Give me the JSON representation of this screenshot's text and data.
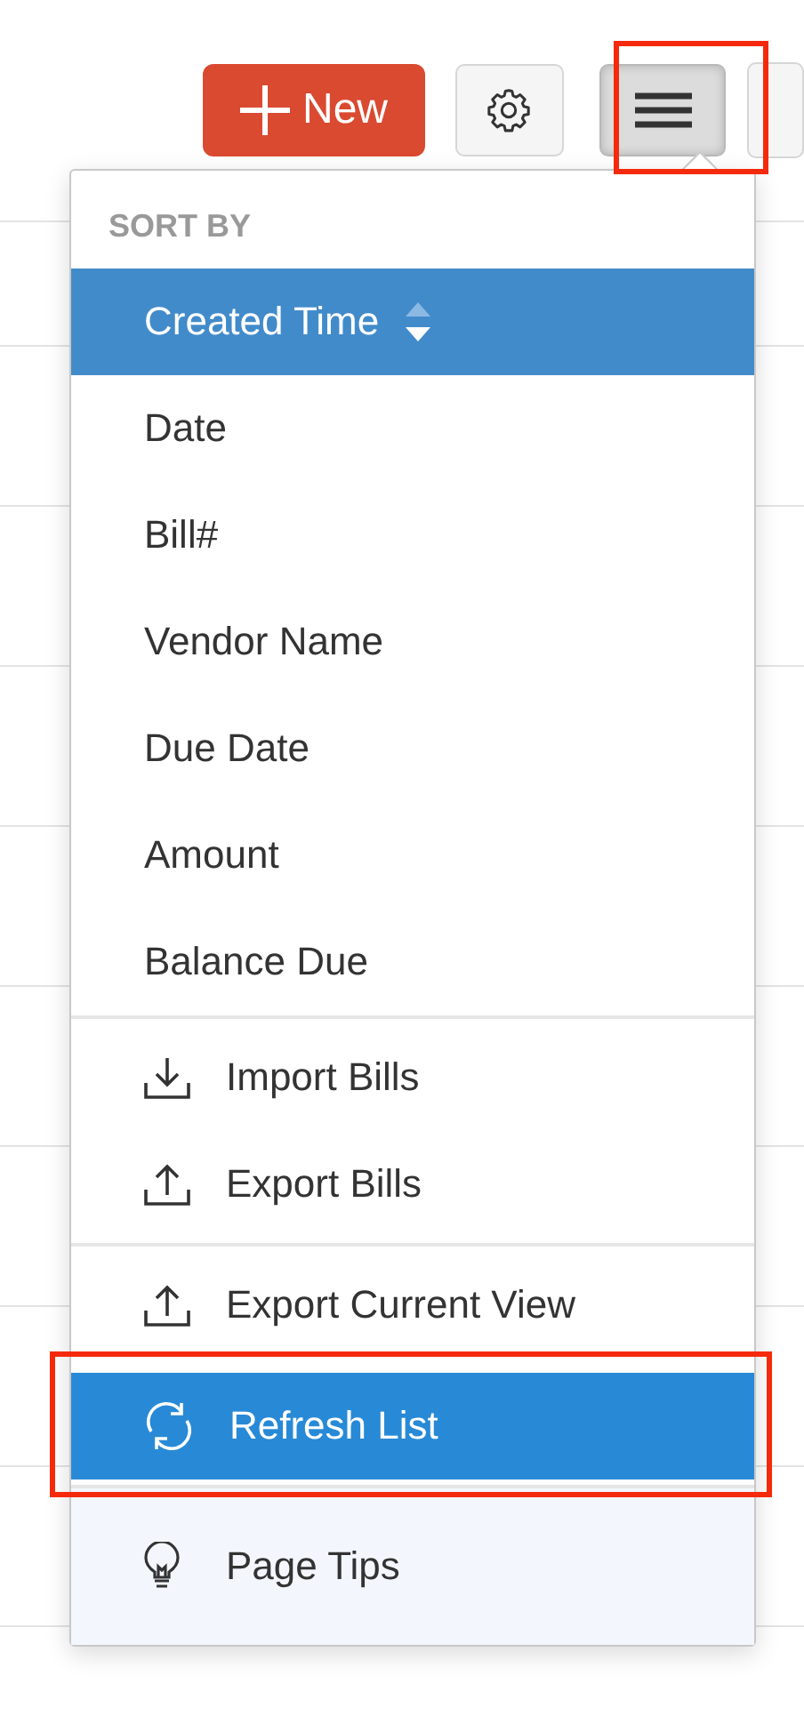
{
  "toolbar": {
    "new_button": {
      "label": "New"
    },
    "menu_button": {
      "pressed": true,
      "annotated": true
    }
  },
  "menu": {
    "sort_title": "SORT BY",
    "sort_options": [
      {
        "label": "Created Time",
        "selected": true
      },
      {
        "label": "Date",
        "selected": false
      },
      {
        "label": "Bill#",
        "selected": false
      },
      {
        "label": "Vendor Name",
        "selected": false
      },
      {
        "label": "Due Date",
        "selected": false
      },
      {
        "label": "Amount",
        "selected": false
      },
      {
        "label": "Balance Due",
        "selected": false
      }
    ],
    "action_groups": [
      [
        {
          "kind": "import",
          "label": "Import Bills",
          "hovered": false,
          "annotated": false
        },
        {
          "kind": "export",
          "label": "Export Bills",
          "hovered": false,
          "annotated": false
        }
      ],
      [
        {
          "kind": "export",
          "label": "Export Current View",
          "hovered": false,
          "annotated": false
        },
        {
          "kind": "refresh",
          "label": "Refresh List",
          "hovered": true,
          "annotated": true
        }
      ]
    ],
    "footer": {
      "kind": "tips",
      "label": "Page Tips"
    }
  }
}
